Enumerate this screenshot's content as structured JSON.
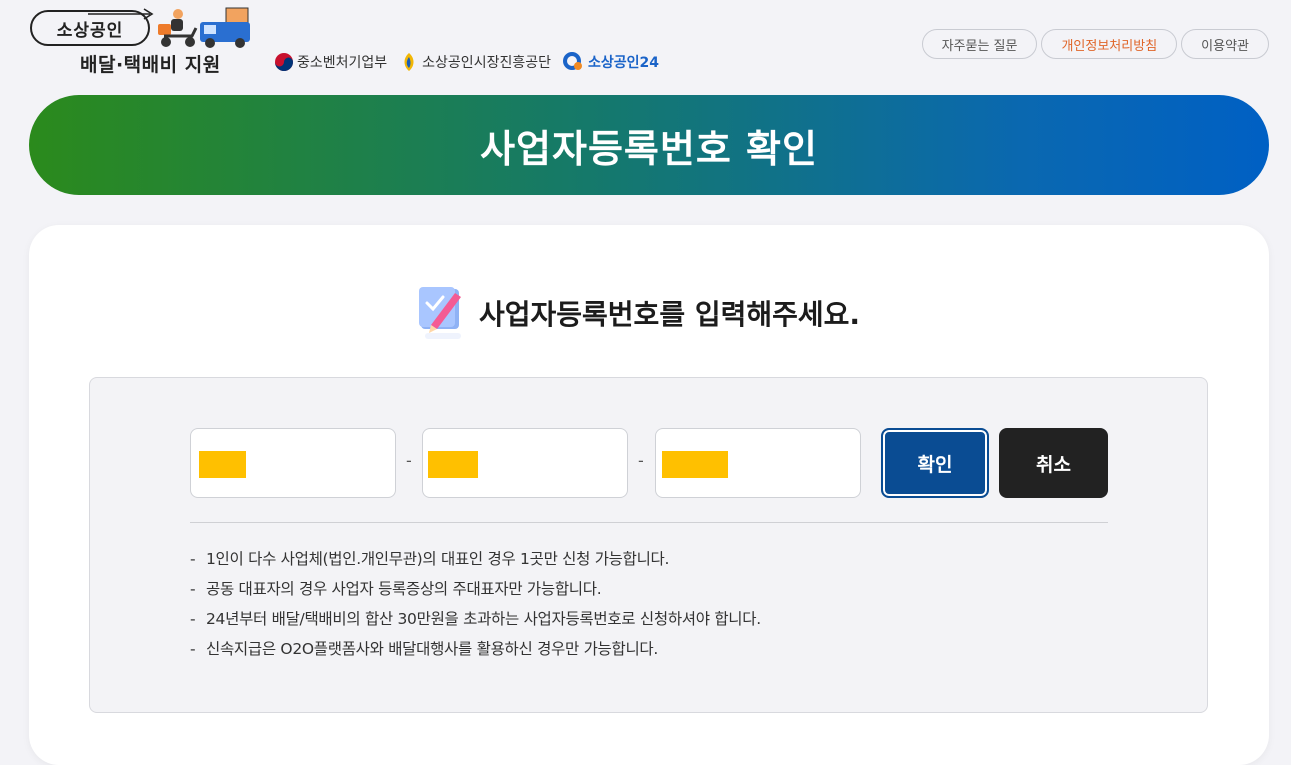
{
  "logo": {
    "line1": "소상공인",
    "line2": "배달·택배비 지원"
  },
  "orgs": [
    {
      "label": "중소벤처기업부"
    },
    {
      "label": "소상공인시장진흥공단"
    },
    {
      "label": "소상공인24"
    }
  ],
  "top_links": {
    "faq": "자주묻는 질문",
    "privacy": "개인정보처리방침",
    "terms": "이용약관"
  },
  "banner": {
    "title": "사업자등록번호 확인"
  },
  "form": {
    "prompt": "사업자등록번호를 입력해주세요.",
    "separator": "-",
    "confirm_label": "확인",
    "cancel_label": "취소",
    "fields_redacted": true
  },
  "notes": [
    "1인이 다수 사업체(법인.개인무관)의 대표인 경우 1곳만 신청 가능합니다.",
    "공동 대표자의 경우 사업자 등록증상의 주대표자만 가능합니다.",
    "24년부터 배달/택배비의 합산 30만원을 초과하는 사업자등록번호로 신청하셔야 합니다.",
    "신속지급은 O2O플랫폼사와 배달대행사를 활용하신 경우만 가능합니다."
  ],
  "note_marker": "-",
  "colors": {
    "banner_start": "#2b8a1c",
    "banner_end": "#0060c4",
    "confirm_button": "#0a4c93",
    "cancel_button": "#222222",
    "redaction": "#ffc000",
    "privacy_link": "#e0662a"
  },
  "icons": [
    "delivery-scooter-icon",
    "delivery-truck-icon",
    "taegeuk-emblem-icon",
    "semas-emblem-icon",
    "sosang24-icon",
    "pen-checklist-icon"
  ]
}
